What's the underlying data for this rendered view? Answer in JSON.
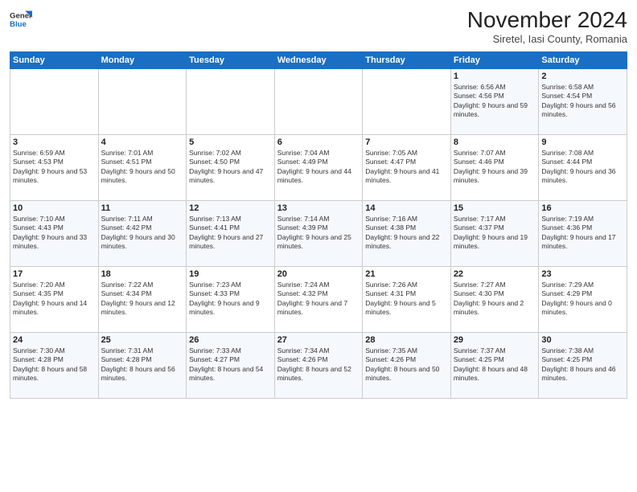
{
  "header": {
    "logo_line1": "General",
    "logo_line2": "Blue",
    "month_title": "November 2024",
    "subtitle": "Siretel, Iasi County, Romania"
  },
  "weekdays": [
    "Sunday",
    "Monday",
    "Tuesday",
    "Wednesday",
    "Thursday",
    "Friday",
    "Saturday"
  ],
  "weeks": [
    [
      {
        "day": "",
        "info": ""
      },
      {
        "day": "",
        "info": ""
      },
      {
        "day": "",
        "info": ""
      },
      {
        "day": "",
        "info": ""
      },
      {
        "day": "",
        "info": ""
      },
      {
        "day": "1",
        "info": "Sunrise: 6:56 AM\nSunset: 4:56 PM\nDaylight: 9 hours and 59 minutes."
      },
      {
        "day": "2",
        "info": "Sunrise: 6:58 AM\nSunset: 4:54 PM\nDaylight: 9 hours and 56 minutes."
      }
    ],
    [
      {
        "day": "3",
        "info": "Sunrise: 6:59 AM\nSunset: 4:53 PM\nDaylight: 9 hours and 53 minutes."
      },
      {
        "day": "4",
        "info": "Sunrise: 7:01 AM\nSunset: 4:51 PM\nDaylight: 9 hours and 50 minutes."
      },
      {
        "day": "5",
        "info": "Sunrise: 7:02 AM\nSunset: 4:50 PM\nDaylight: 9 hours and 47 minutes."
      },
      {
        "day": "6",
        "info": "Sunrise: 7:04 AM\nSunset: 4:49 PM\nDaylight: 9 hours and 44 minutes."
      },
      {
        "day": "7",
        "info": "Sunrise: 7:05 AM\nSunset: 4:47 PM\nDaylight: 9 hours and 41 minutes."
      },
      {
        "day": "8",
        "info": "Sunrise: 7:07 AM\nSunset: 4:46 PM\nDaylight: 9 hours and 39 minutes."
      },
      {
        "day": "9",
        "info": "Sunrise: 7:08 AM\nSunset: 4:44 PM\nDaylight: 9 hours and 36 minutes."
      }
    ],
    [
      {
        "day": "10",
        "info": "Sunrise: 7:10 AM\nSunset: 4:43 PM\nDaylight: 9 hours and 33 minutes."
      },
      {
        "day": "11",
        "info": "Sunrise: 7:11 AM\nSunset: 4:42 PM\nDaylight: 9 hours and 30 minutes."
      },
      {
        "day": "12",
        "info": "Sunrise: 7:13 AM\nSunset: 4:41 PM\nDaylight: 9 hours and 27 minutes."
      },
      {
        "day": "13",
        "info": "Sunrise: 7:14 AM\nSunset: 4:39 PM\nDaylight: 9 hours and 25 minutes."
      },
      {
        "day": "14",
        "info": "Sunrise: 7:16 AM\nSunset: 4:38 PM\nDaylight: 9 hours and 22 minutes."
      },
      {
        "day": "15",
        "info": "Sunrise: 7:17 AM\nSunset: 4:37 PM\nDaylight: 9 hours and 19 minutes."
      },
      {
        "day": "16",
        "info": "Sunrise: 7:19 AM\nSunset: 4:36 PM\nDaylight: 9 hours and 17 minutes."
      }
    ],
    [
      {
        "day": "17",
        "info": "Sunrise: 7:20 AM\nSunset: 4:35 PM\nDaylight: 9 hours and 14 minutes."
      },
      {
        "day": "18",
        "info": "Sunrise: 7:22 AM\nSunset: 4:34 PM\nDaylight: 9 hours and 12 minutes."
      },
      {
        "day": "19",
        "info": "Sunrise: 7:23 AM\nSunset: 4:33 PM\nDaylight: 9 hours and 9 minutes."
      },
      {
        "day": "20",
        "info": "Sunrise: 7:24 AM\nSunset: 4:32 PM\nDaylight: 9 hours and 7 minutes."
      },
      {
        "day": "21",
        "info": "Sunrise: 7:26 AM\nSunset: 4:31 PM\nDaylight: 9 hours and 5 minutes."
      },
      {
        "day": "22",
        "info": "Sunrise: 7:27 AM\nSunset: 4:30 PM\nDaylight: 9 hours and 2 minutes."
      },
      {
        "day": "23",
        "info": "Sunrise: 7:29 AM\nSunset: 4:29 PM\nDaylight: 9 hours and 0 minutes."
      }
    ],
    [
      {
        "day": "24",
        "info": "Sunrise: 7:30 AM\nSunset: 4:28 PM\nDaylight: 8 hours and 58 minutes."
      },
      {
        "day": "25",
        "info": "Sunrise: 7:31 AM\nSunset: 4:28 PM\nDaylight: 8 hours and 56 minutes."
      },
      {
        "day": "26",
        "info": "Sunrise: 7:33 AM\nSunset: 4:27 PM\nDaylight: 8 hours and 54 minutes."
      },
      {
        "day": "27",
        "info": "Sunrise: 7:34 AM\nSunset: 4:26 PM\nDaylight: 8 hours and 52 minutes."
      },
      {
        "day": "28",
        "info": "Sunrise: 7:35 AM\nSunset: 4:26 PM\nDaylight: 8 hours and 50 minutes."
      },
      {
        "day": "29",
        "info": "Sunrise: 7:37 AM\nSunset: 4:25 PM\nDaylight: 8 hours and 48 minutes."
      },
      {
        "day": "30",
        "info": "Sunrise: 7:38 AM\nSunset: 4:25 PM\nDaylight: 8 hours and 46 minutes."
      }
    ]
  ]
}
